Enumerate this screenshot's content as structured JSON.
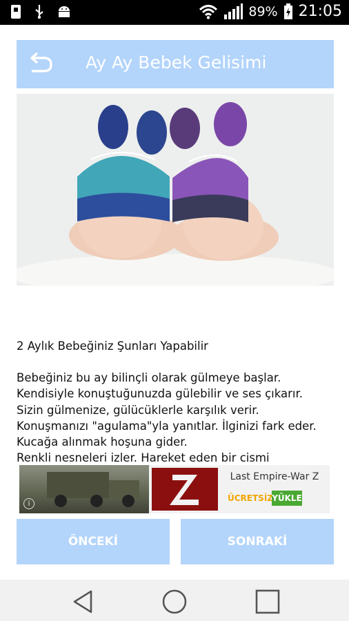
{
  "status_bar": {
    "battery": "89%",
    "time": "21:05"
  },
  "header": {
    "title": "Ay Ay Bebek Gelisimi"
  },
  "article": {
    "heading": "2 Aylık Bebeğiniz Şunları Yapabilir",
    "lines": [
      "Bebeğiniz bu ay bilinçli olarak gülmeye başlar.",
      "Kendisiyle konuştuğunuzda gülebilir ve ses çıkarır.",
      "Sizin gülmenize, gülücüklerle karşılık verir.",
      "Konuşmanızı \"agulama\"yla yanıtlar. İlginizi fark eder.",
      "Kucağa alınmak hoşuna gider.",
      "Renkli nesneleri izler. Hareket eden bir cismi"
    ]
  },
  "ad": {
    "title": "Last Empire-War Z",
    "free_label": "ÜCRETSİZ",
    "install_label": "YÜKLE",
    "info_icon": "i"
  },
  "buttons": {
    "previous": "ÖNCEKİ",
    "next": "SONRAKİ"
  }
}
